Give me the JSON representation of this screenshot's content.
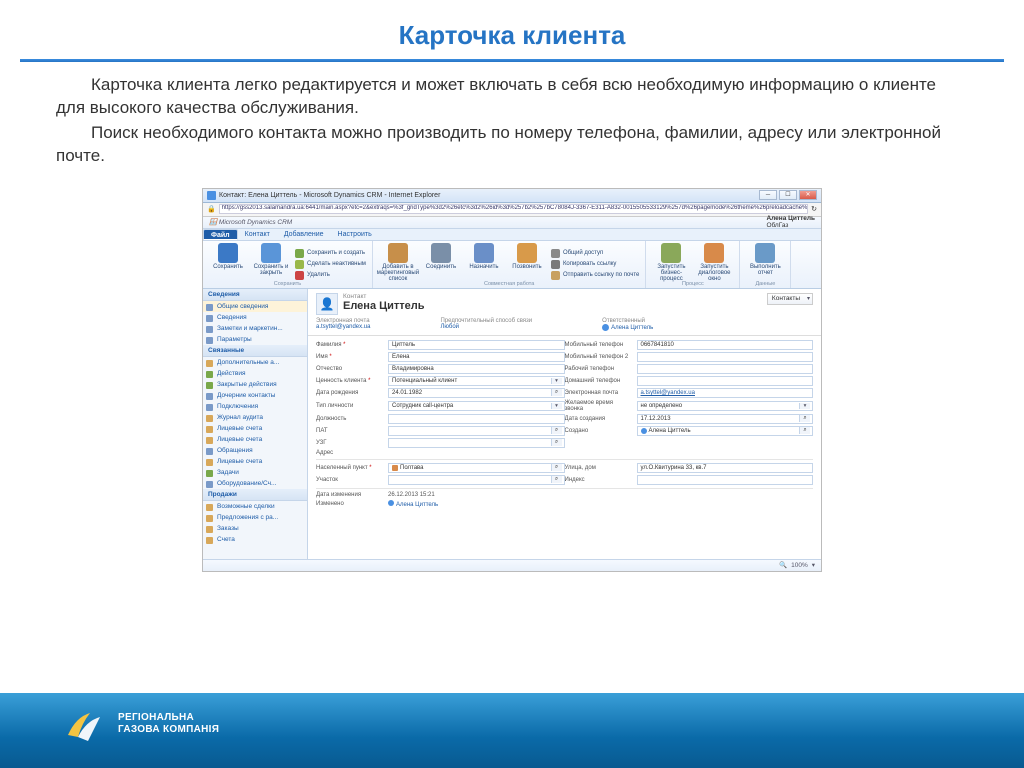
{
  "slide": {
    "title": "Карточка клиента",
    "para1": "Карточка  клиента легко редактируется и может включать  в себя всю необходимую информацию о клиенте для высокого качества обслуживания.",
    "para2": "Поиск необходимого контакта можно производить по номеру телефона, фамилии, адресу или электронной почте."
  },
  "ie": {
    "title": "Контакт: Елена Циттель - Microsoft Dynamics CRM - Internet Explorer",
    "url": "https://gss2013.salamandra.ua:6441/main.aspx?etc=2&extraqs=%3f_gridType%3d2%26etc%3d2%26id%3d%257b2%257bC78084J-3367-E311-A832-0015505533129%257d%26pagemode%26theme%26preloadcache%3d13454570208672&pagetype=entityrecord"
  },
  "crm": {
    "brand": "Microsoft Dynamics CRM",
    "user": "Алена Циттель",
    "org": "ОблГаз",
    "tabs": {
      "t0": "Файл",
      "t1": "Контакт",
      "t2": "Добавление",
      "t3": "Настроить"
    },
    "ribbon": {
      "save": "Сохранить",
      "saveclose": "Сохранить и закрыть",
      "delete": "Удалить",
      "savenew": "Сохранить и создать",
      "deactivate": "Сделать неактивным",
      "grp_save": "Сохранить",
      "addlist": "Добавить в маркетинговый список",
      "connect": "Соединить",
      "assign": "Назначить",
      "call": "Позвонить",
      "share": "Общий доступ",
      "copy": "Копировать ссылку",
      "email": "Отправить ссылку по почте",
      "grp_collab": "Совместная работа",
      "workflow": "Запустить бизнес-процесс",
      "dialog": "Запустить диалоговое окно",
      "grp_process": "Процесс",
      "report": "Выполнить отчет",
      "grp_data": "Данные"
    },
    "sidebar": {
      "sec1": "Сведения",
      "i1": "Общие сведения",
      "i2": "Сведения",
      "i3": "Заметки и маркетин...",
      "i4": "Параметры",
      "sec2": "Связанные",
      "r1": "Дополнительные а...",
      "r2": "Действия",
      "r3": "Закрытые действия",
      "r4": "Дочерние контакты",
      "r5": "Подключения",
      "r6": "Журнал аудита",
      "r7": "Лицевые счета",
      "r8": "Лицевые счета",
      "r9": "Обращения",
      "r10": "Лицевые счета",
      "r11": "Задачи",
      "r12": "Оборудование/Сч...",
      "sec3": "Продажи",
      "p1": "Возможные сделки",
      "p2": "Предложения с ра...",
      "p3": "Заказы",
      "p4": "Счета"
    },
    "entity": {
      "type": "Контакт",
      "name": "Елена Циттель",
      "emailLbl": "Электронная почта",
      "emailVal": "a.tsyttel@yandex.ua",
      "prefLbl": "Предпочтительный способ связи",
      "prefVal": "Любой",
      "ownerLbl": "Ответственный",
      "ownerVal": "Алена Циттель",
      "dd": "Контакты"
    },
    "form": {
      "lastname_l": "Фамилия",
      "lastname_v": "Циттель",
      "mobile_l": "Мобильный телефон",
      "mobile_v": "0667841810",
      "firstname_l": "Имя",
      "firstname_v": "Елена",
      "mobile2_l": "Мобильный телефон 2",
      "middle_l": "Отчество",
      "middle_v": "Владимировна",
      "workphone_l": "Рабочий телефон",
      "value_l": "Ценность клиента",
      "value_v": "Потенциальный клиент",
      "homephone_l": "Домашний телефон",
      "birth_l": "Дата рождения",
      "birth_v": "24.01.1982",
      "email2_l": "Электронная почта",
      "email2_v": "a.tsyttel@yandex.ua",
      "type_l": "Тип личности",
      "type_v": "Сотрудник call-центра",
      "calltime_l": "Желаемое время звонка",
      "calltime_v": "не определено",
      "position_l": "Должность",
      "created_l": "Дата создания",
      "created_v": "17.12.2013",
      "pat_l": "ПАТ",
      "createdby_l": "Создано",
      "createdby_v": "Алена Циттель",
      "uzg_l": "УЗГ",
      "addr_l": "Адрес",
      "city_l": "Населенный пункт",
      "city_v": "Полтава",
      "street_l": "Улица, дом",
      "street_v": "ул.О.Квитурина 33, кв.7",
      "district_l": "Участок",
      "index_l": "Индекс",
      "modon_l": "Дата изменения",
      "modon_v": "26.12.2013 15:21",
      "modby_l": "Изменено",
      "modby_v": "Алена Циттель"
    },
    "zoom": "100%"
  },
  "footer": {
    "l1": "РЕГІОНАЛЬНА",
    "l2": "ГАЗОВА КОМПАНІЯ"
  }
}
